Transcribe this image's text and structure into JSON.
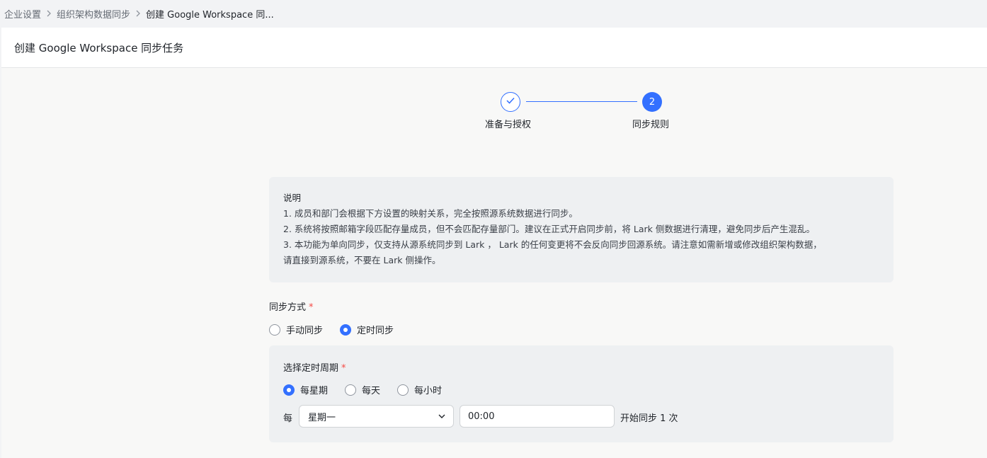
{
  "breadcrumb": {
    "items": [
      "企业设置",
      "组织架构数据同步",
      "创建 Google Workspace 同..."
    ]
  },
  "page": {
    "title": "创建 Google Workspace 同步任务"
  },
  "stepper": {
    "steps": [
      {
        "label": "准备与授权",
        "status": "done",
        "icon": "check-icon"
      },
      {
        "label": "同步规则",
        "status": "active",
        "number": "2"
      }
    ]
  },
  "notice": {
    "title": "说明",
    "lines": [
      "1. 成员和部门会根据下方设置的映射关系，完全按照源系统数据进行同步。",
      "2. 系统将按照邮箱字段匹配存量成员，但不会匹配存量部门。建议在正式开启同步前，将 Lark 侧数据进行清理，避免同步后产生混乱。",
      "3. 本功能为单向同步，仅支持从源系统同步到 Lark ， Lark 的任何变更将不会反向同步回源系统。请注意如需新增或修改组织架构数据，",
      "请直接到源系统，不要在 Lark 侧操作。"
    ]
  },
  "sync_mode": {
    "label": "同步方式",
    "required_mark": "*",
    "options": [
      "手动同步",
      "定时同步"
    ],
    "selected": "定时同步"
  },
  "schedule": {
    "label": "选择定时周期",
    "required_mark": "*",
    "options": [
      "每星期",
      "每天",
      "每小时"
    ],
    "selected": "每星期",
    "prefix": "每",
    "weekday": "星期一",
    "time": "00:00",
    "suffix": "开始同步 1 次"
  },
  "colors": {
    "accent": "#3370ff",
    "required": "#f54a45",
    "panel_bg": "#eef0f2"
  }
}
